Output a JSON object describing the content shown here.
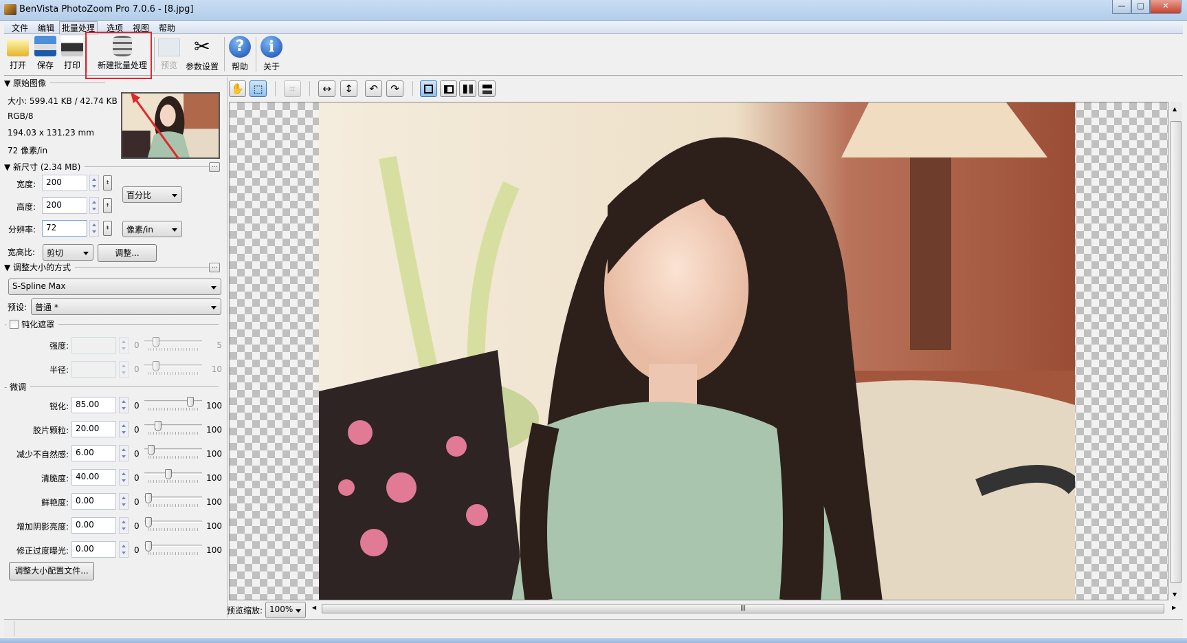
{
  "window": {
    "title": "BenVista PhotoZoom Pro 7.0.6 - [8.jpg]",
    "minimize": "—",
    "maximize": "□",
    "close": "✕"
  },
  "menu": [
    "文件",
    "编辑",
    "批量处理",
    "选项",
    "视图",
    "帮助"
  ],
  "toolbar": {
    "open": "打开",
    "save": "保存",
    "print": "打印",
    "new_batch": "新建批量处理",
    "preview": "预览",
    "settings": "参数设置",
    "help": "帮助",
    "about": "关于"
  },
  "original": {
    "header": "原始图像",
    "size": "大小: 599.41 KB / 42.74 KB",
    "mode": "RGB/8",
    "dimensions": "194.03 x 131.23 mm",
    "resolution": "72 像素/in"
  },
  "new_size": {
    "header": "新尺寸 (2.34 MB)",
    "more": "...",
    "width_label": "宽度:",
    "width": "200",
    "height_label": "高度:",
    "height": "200",
    "res_label": "分辨率:",
    "res": "72",
    "unit": "百分比",
    "res_unit": "像素/in",
    "aspect_label": "宽高比:",
    "aspect": "剪切",
    "adjust": "调整..."
  },
  "method": {
    "header": "调整大小的方式",
    "more": "...",
    "algorithm": "S-Spline Max",
    "preset_label": "预设:",
    "preset": "普通 *"
  },
  "unsharp": {
    "label": "钝化遮罩",
    "checked": false,
    "rows": [
      {
        "label": "强度:",
        "min": "0",
        "max": "5",
        "value": 1
      },
      {
        "label": "半径:",
        "min": "0",
        "max": "10",
        "value": 2
      }
    ]
  },
  "finetune": {
    "header": "微调",
    "rows": [
      {
        "label": "锐化:",
        "value": "85.00",
        "min": "0",
        "max": "100",
        "fraction": 0.85
      },
      {
        "label": "胶片颗粒:",
        "value": "20.00",
        "min": "0",
        "max": "100",
        "fraction": 0.2
      },
      {
        "label": "减少不自然感:",
        "value": "6.00",
        "min": "0",
        "max": "100",
        "fraction": 0.06
      },
      {
        "label": "清脆度:",
        "value": "40.00",
        "min": "0",
        "max": "100",
        "fraction": 0.4
      },
      {
        "label": "鲜艳度:",
        "value": "0.00",
        "min": "0",
        "max": "100",
        "fraction": 0
      },
      {
        "label": "增加阴影亮度:",
        "value": "0.00",
        "min": "0",
        "max": "100",
        "fraction": 0
      },
      {
        "label": "修正过度曝光:",
        "value": "0.00",
        "min": "0",
        "max": "100",
        "fraction": 0
      }
    ]
  },
  "profile_button": "调整大小配置文件...",
  "preview_zoom": {
    "label": "预览缩放:",
    "value": "100%"
  },
  "view_toolbar": {
    "hand": "✋",
    "select": "⬚",
    "crop": "⌗",
    "fit_width": "↔",
    "fit_height": "↕",
    "rotate_left": "↶",
    "rotate_right": "↷"
  },
  "accent": {
    "highlight": "#e0262c"
  }
}
